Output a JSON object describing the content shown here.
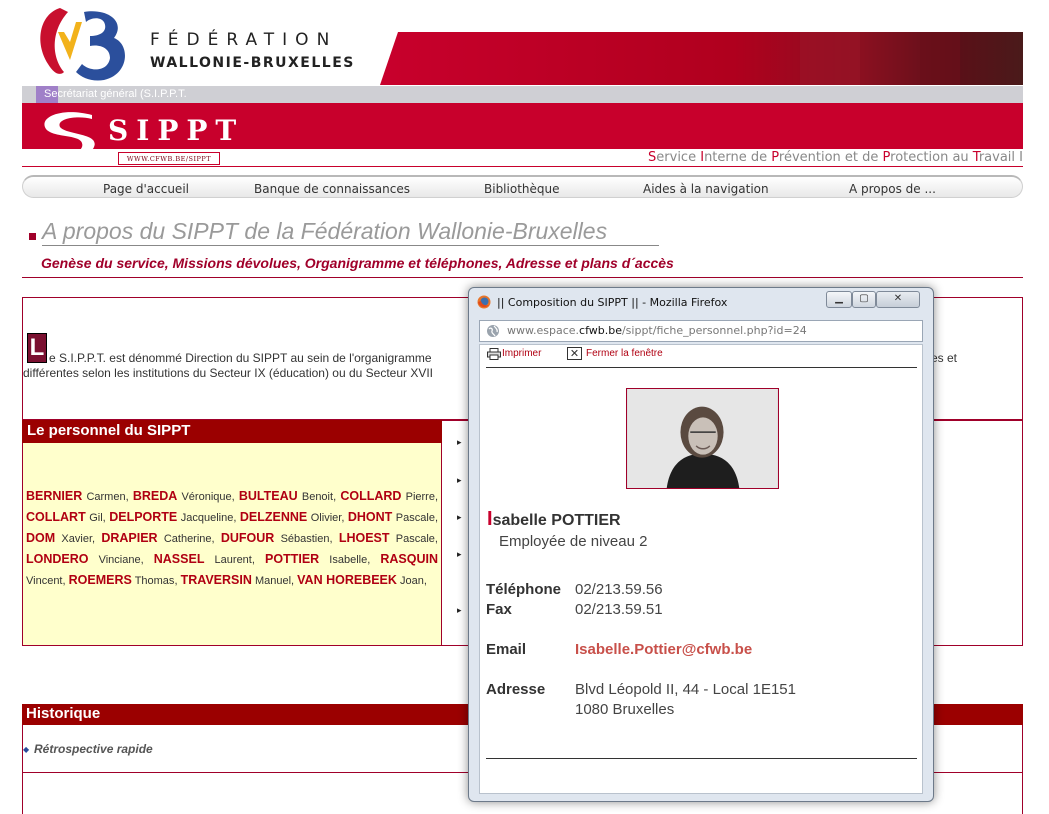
{
  "header": {
    "fed_line1": "FÉDÉRATION",
    "fed_line2": "WALLONIE-BRUXELLES",
    "secretariat": "Secrétariat général (S.I.P.P.T.",
    "sippt_logo": "SIPPT",
    "url_tag": "WWW.CFWB.BE/SIPPT",
    "service_words": [
      {
        "cap": "S",
        "rest": "ervice "
      },
      {
        "cap": "I",
        "rest": "nterne de "
      },
      {
        "cap": "P",
        "rest": "révention et de "
      },
      {
        "cap": "P",
        "rest": "rotection au "
      },
      {
        "cap": "T",
        "rest": "ravail I"
      }
    ],
    "colors": {
      "brand_red": "#c8002c",
      "dark_red": "#9b0000"
    }
  },
  "nav": {
    "items": [
      "Page d'accueil",
      "Banque de connaissances",
      "Bibliothèque",
      "Aides à la navigation",
      "A propos de ..."
    ]
  },
  "page": {
    "title": "A propos du SIPPT de la Fédération Wallonie-Bruxelles",
    "subtitle": "Genèse du service, Missions dévolues, Organigramme et téléphones, Adresse et plans d´accès"
  },
  "intro": {
    "dropcap": "L",
    "line1": "e S.I.P.P.T. est dénommé Direction du SIPPT au sein de l'organigramme",
    "line2": "différentes selon les institutions du Secteur IX (éducation) ou du Secteur XVII",
    "tail": "es et"
  },
  "staff": {
    "header": "Le personnel du SIPPT",
    "people": [
      {
        "last": "BERNIER",
        "first": "Carmen"
      },
      {
        "last": "BREDA",
        "first": "Véronique"
      },
      {
        "last": "BULTEAU",
        "first": "Benoit"
      },
      {
        "last": "COLLARD",
        "first": "Pierre"
      },
      {
        "last": "COLLART",
        "first": "Gil"
      },
      {
        "last": "DELPORTE",
        "first": "Jacqueline"
      },
      {
        "last": "DELZENNE",
        "first": "Olivier"
      },
      {
        "last": "DHONT",
        "first": "Pascale"
      },
      {
        "last": "DOM",
        "first": "Xavier"
      },
      {
        "last": "DRAPIER",
        "first": "Catherine"
      },
      {
        "last": "DUFOUR",
        "first": "Sébastien"
      },
      {
        "last": "LHOEST",
        "first": "Pascale"
      },
      {
        "last": "LONDERO",
        "first": "Vinciane"
      },
      {
        "last": "NASSEL",
        "first": "Laurent"
      },
      {
        "last": "POTTIER",
        "first": "Isabelle"
      },
      {
        "last": "RASQUIN",
        "first": "Vincent"
      },
      {
        "last": "ROEMERS",
        "first": "Thomas"
      },
      {
        "last": "TRAVERSIN",
        "first": "Manuel"
      },
      {
        "last": "VAN HOREBEEK",
        "first": "Joan"
      }
    ],
    "arrow_glyph": "▸"
  },
  "historique": {
    "header": "Historique",
    "link": "Rétrospective rapide"
  },
  "popup": {
    "title": "|| Composition du SIPPT || - Mozilla Firefox",
    "url_prefix": "www.espace.",
    "url_domain": "cfwb.be",
    "url_suffix": "/sippt/fiche_personnel.php?id=24",
    "print_label": "Imprimer",
    "close_label": "Fermer la fenêtre",
    "name_initial": "I",
    "name_rest": "sabelle POTTIER",
    "role": "Employée de niveau 2",
    "phone_label": "Téléphone",
    "phone": "02/213.59.56",
    "fax_label": "Fax",
    "fax": "02/213.59.51",
    "email_label": "Email",
    "email": "Isabelle.Pottier@cfwb.be",
    "address_label": "Adresse",
    "address_line1": "Blvd Léopold II, 44 - Local 1E151",
    "address_line2": "1080 Bruxelles"
  }
}
